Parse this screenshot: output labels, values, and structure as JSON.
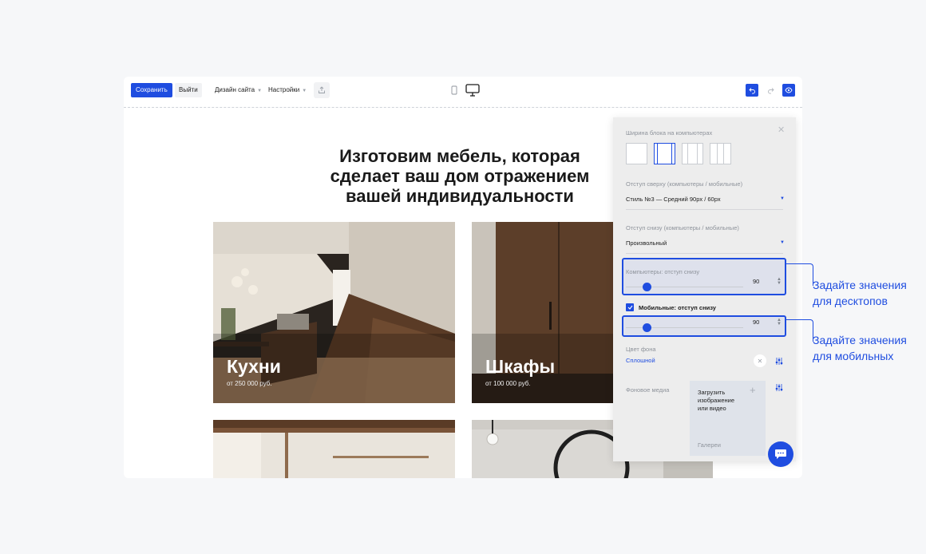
{
  "toolbar": {
    "save_label": "Сохранить",
    "exit_label": "Выйти",
    "design_label": "Дизайн сайта",
    "settings_label": "Настройки",
    "accent": "#1f4de0"
  },
  "page": {
    "heading_line1": "Изготовим мебель, которая",
    "heading_line2": "сделает ваш дом отражением",
    "heading_line3": "вашей индивидуальности",
    "tiles": [
      {
        "title": "Кухни",
        "price": "от 250 000 руб."
      },
      {
        "title": "Шкафы",
        "price": "от 100 000 руб."
      }
    ]
  },
  "panel": {
    "block_width_label": "Ширина блока на компьютерах",
    "top_padding_label": "Отступ сверху (компьютеры / мобильные)",
    "top_padding_value": "Стиль №3 — Средний 90px / 60px",
    "bottom_padding_label": "Отступ снизу (компьютеры / мобильные)",
    "bottom_padding_value": "Произвольный",
    "desktop_bottom_label": "Компьютеры: отступ снизу",
    "desktop_bottom_value": "90",
    "mobile_bottom_label": "Мобильные: отступ снизу",
    "mobile_bottom_value": "90",
    "bg_color_label": "Цвет фона",
    "bg_color_value": "Сплошной",
    "bg_media_label": "Фоновое медиа",
    "upload_line1": "Загрузить",
    "upload_line2": "изображение",
    "upload_line3": "или видео",
    "gallery_label": "Галереи"
  },
  "annotations": {
    "desktop_line1": "Задайте значения",
    "desktop_line2": "для десктопов",
    "mobile_line1": "Задайте значения",
    "mobile_line2": "для мобильных"
  }
}
